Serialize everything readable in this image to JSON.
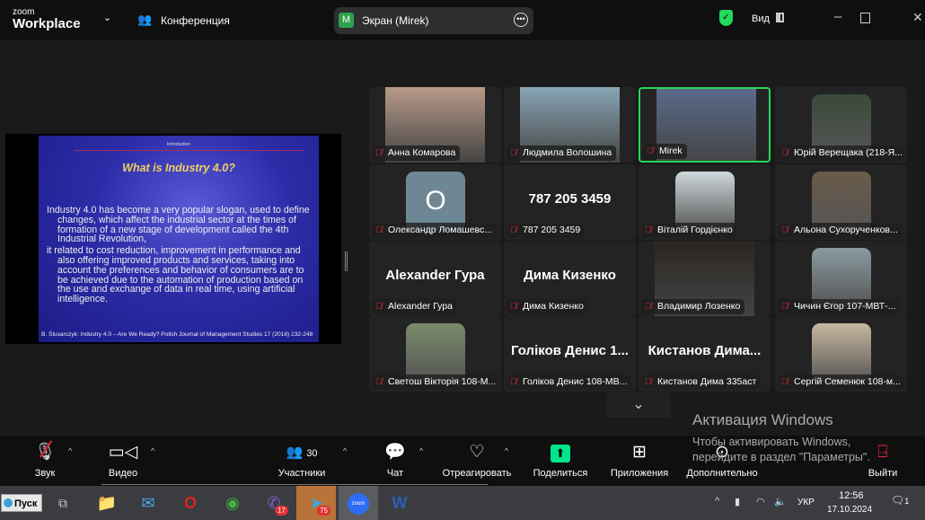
{
  "app": {
    "logo_small": "zoom",
    "logo_big": "Workplace",
    "meeting_label": "Конференция",
    "share_pill": {
      "initial": "M",
      "title": "Экран (Mirek)"
    },
    "view_label": "Вид",
    "accent": "#23d959"
  },
  "slide": {
    "header": "Introduction",
    "title": "What is Industry 4.0?",
    "paragraphs": [
      "Industry 4.0 has become a very popular slogan, used to define changes, which affect the industrial sector at the times of formation of a new stage of development called the 4th Industrial Revolution,",
      "it related to cost reduction, improvement in performance and also offering improved products and services, taking into account the preferences and behavior of consumers are to be achieved due to the automation of production based on the use and exchange of data in real time, using artificial intelligence."
    ],
    "citation": "B. Ślusarczyk: Industry 4.0 – Are We Ready? Polish Journal of Management Studies 17 (2018) 232-248"
  },
  "participants": [
    {
      "name": "Анна Комарова",
      "type": "video",
      "color": "#b89a88"
    },
    {
      "name": "Людмила Волошина",
      "type": "video",
      "color": "#8aa6b6"
    },
    {
      "name": "Mirek",
      "type": "video",
      "color": "#5a6a8a",
      "active": true
    },
    {
      "name": "Юрій Верещака (218-Я...",
      "type": "avatar",
      "color": "#3a4a3a"
    },
    {
      "name": "Олександр Ломашевс...",
      "type": "letter",
      "letter": "O",
      "color": "#6e8794"
    },
    {
      "name": "787 205 3459",
      "type": "text",
      "big": "787 205 3459"
    },
    {
      "name": "Віталій Гордієнко",
      "type": "avatar",
      "color": "#cfd8dc"
    },
    {
      "name": "Альона Сухорученков...",
      "type": "avatar",
      "color": "#6a5a4a"
    },
    {
      "name": "Alexander Гура",
      "type": "text",
      "big": "Alexander Гура"
    },
    {
      "name": "Дима Кизенко",
      "type": "text",
      "big": "Дима Кизенко"
    },
    {
      "name": "Владимир Лозенко",
      "type": "video",
      "color": "#2a2622"
    },
    {
      "name": "Чичин Єгор 107-МВТ-...",
      "type": "avatar",
      "color": "#8a9aa0"
    },
    {
      "name": "Светош Вікторія 108-М...",
      "type": "avatar",
      "color": "#7a8a6a"
    },
    {
      "name": "Голіков Денис 108-МВ...",
      "type": "text",
      "big": "Голіков Денис 1..."
    },
    {
      "name": "Кистанов Дима 335аст",
      "type": "text",
      "big": "Кистанов  Дима..."
    },
    {
      "name": "Сергій Семенюк 108-м...",
      "type": "avatar",
      "color": "#c8b8a0"
    }
  ],
  "watermark": {
    "title": "Активация Windows",
    "line1": "Чтобы активировать Windows,",
    "line2": "перейдите в раздел \"Параметры\"."
  },
  "toolbar": {
    "audio": "Звук",
    "video": "Видео",
    "participants": "Участники",
    "participants_count": "30",
    "chat": "Чат",
    "react": "Отреагировать",
    "share": "Поделиться",
    "apps": "Приложения",
    "more": "Дополнительно",
    "leave": "Выйти",
    "share_color": "#00e58c",
    "mute_color": "#e0283a"
  },
  "taskbar": {
    "start": "Пуск",
    "viber_badge": "17",
    "telegram_badge": "75",
    "zoom_label": "zoom",
    "lang": "УКР",
    "time": "12:56",
    "date": "17.10.2024",
    "notif": "1"
  }
}
